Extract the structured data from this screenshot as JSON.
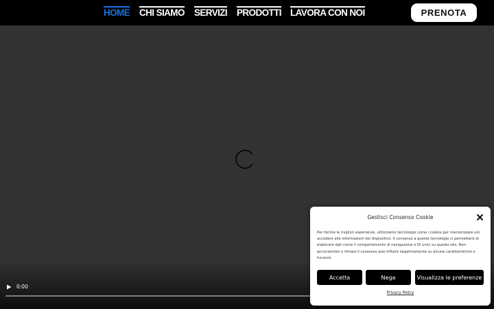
{
  "nav": {
    "items": [
      {
        "label": "HOME",
        "active": true
      },
      {
        "label": "CHI SIAMO",
        "active": false
      },
      {
        "label": "SERVIZI",
        "active": false
      },
      {
        "label": "PRODOTTI",
        "active": false
      },
      {
        "label": "LAVORA CON NOI",
        "active": false
      }
    ],
    "book_label": "PRENOTA"
  },
  "video": {
    "time": "0:00",
    "state_icon": "loading-spinner-icon",
    "play_icon": "play-icon"
  },
  "cookie": {
    "title": "Gestisci Consenso Cookie",
    "text": "Per fornire le migliori esperienze, utilizziamo tecnologie come i cookie per memorizzare e/o accedere alle informazioni del dispositivo. Il consenso a queste tecnologie ci permetterà di elaborare dati come il comportamento di navigazione o ID unici su questo sito. Non acconsentire o ritirare il consenso può influire negativamente su alcune caratteristiche e funzioni.",
    "accept_label": "Accetta",
    "deny_label": "Nega",
    "prefs_label": "Visualizza le preferenze",
    "privacy_label": "Privacy Policy",
    "close_icon": "close-icon"
  },
  "colors": {
    "nav_active": "#1a6fe0",
    "topbar_bg": "#000000",
    "video_bg": "#323232",
    "button_bg": "#000000"
  }
}
